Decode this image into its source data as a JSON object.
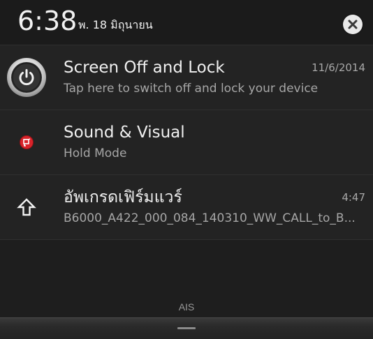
{
  "status": {
    "time": "6:38",
    "date": "พ. 18 มิถุนายน"
  },
  "header": {
    "clear_icon": "close-icon"
  },
  "notifications": [
    {
      "icon": "power-icon",
      "title": "Screen Off and Lock",
      "subtitle": "Tap here to switch off and lock your device",
      "time": "11/6/2014"
    },
    {
      "icon": "sound-visual-icon",
      "title": "Sound & Visual",
      "subtitle": "Hold Mode",
      "time": ""
    },
    {
      "icon": "upload-arrow-icon",
      "title": "อัพเกรดเฟิร์มแวร์",
      "subtitle": "B6000_A422_000_084_140310_WW_CALL_to_B...",
      "time": "4:47"
    }
  ],
  "footer": {
    "carrier": "AIS"
  },
  "colors": {
    "background": "#1c1c1c",
    "notification_bg": "#232323",
    "sound_icon_red": "#d8232a"
  }
}
